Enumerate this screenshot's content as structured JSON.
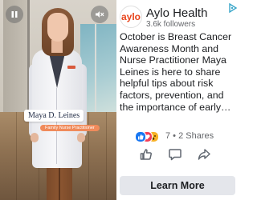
{
  "video": {
    "name_tag": "Maya D. Leines",
    "title_tag": "Family Nurse Practitioner"
  },
  "brand": {
    "avatar_text": "aylo",
    "name": "Aylo Health",
    "followers": "3.6k followers",
    "accent": "#e8441b"
  },
  "post": {
    "body": "October is Breast Cancer Awareness Month and Nurse Practitioner Maya Leines is here to share helpful tips about risk factors, prevention, and the importance of early…"
  },
  "engagement": {
    "reaction_icons": [
      "like-icon",
      "love-icon",
      "wow-icon"
    ],
    "counts": "7 • 2 Shares"
  },
  "actions": [
    "like-icon",
    "comment-icon",
    "share-icon"
  ],
  "cta": {
    "label": "Learn More"
  }
}
